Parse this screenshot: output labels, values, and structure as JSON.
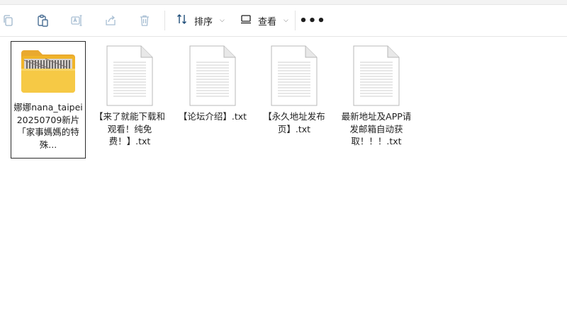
{
  "toolbar": {
    "sort_label": "排序",
    "view_label": "查看",
    "more_label": "•••"
  },
  "files": [
    {
      "name": "娜娜nana_taipei20250709新片「家事媽媽的特殊...",
      "type": "folder",
      "selected": true
    },
    {
      "name": "【来了就能下载和观看！纯免费！】.txt",
      "type": "txt",
      "selected": false
    },
    {
      "name": "【论坛介绍】.txt",
      "type": "txt",
      "selected": false
    },
    {
      "name": "【永久地址发布页】.txt",
      "type": "txt",
      "selected": false
    },
    {
      "name": "最新地址及APP请发邮箱自动获取！！！.txt",
      "type": "txt",
      "selected": false
    }
  ]
}
